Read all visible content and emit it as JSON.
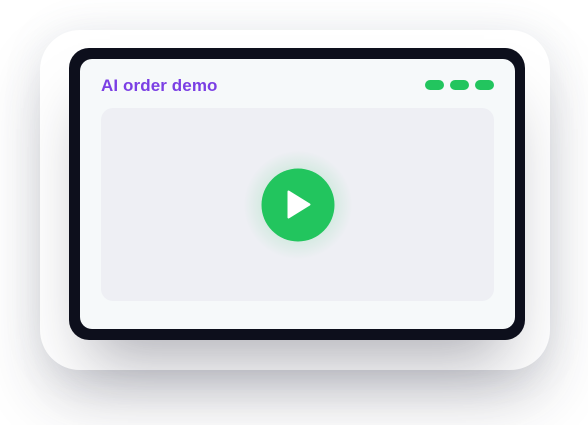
{
  "app": {
    "title": "AI order demo"
  },
  "window_controls": {
    "count": 3,
    "color": "#22c55e"
  },
  "player": {
    "play_icon": "play-icon",
    "accent_color": "#22c55e"
  },
  "colors": {
    "title": "#7b3fe4",
    "device_frame": "#0d0f1c",
    "screen_bg": "#f6f9fa",
    "video_bg": "#eeeff4"
  }
}
